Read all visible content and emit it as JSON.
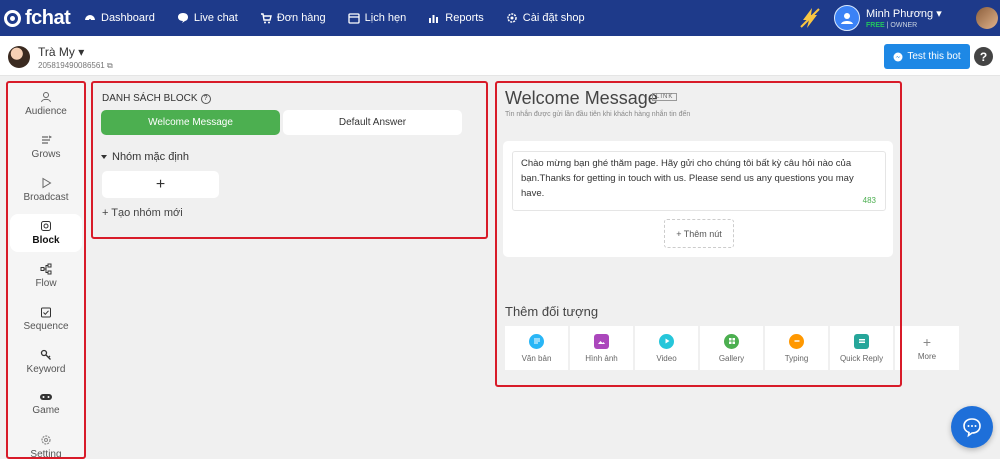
{
  "brand": {
    "name": "fchat"
  },
  "nav": {
    "items": [
      {
        "label": "Dashboard",
        "icon": "dashboard-icon"
      },
      {
        "label": "Live chat",
        "icon": "chat-icon"
      },
      {
        "label": "Đơn hàng",
        "icon": "cart-icon"
      },
      {
        "label": "Lịch hẹn",
        "icon": "calendar-icon"
      },
      {
        "label": "Reports",
        "icon": "chart-icon"
      },
      {
        "label": "Cài đặt shop",
        "icon": "gear-icon"
      }
    ],
    "user": {
      "name": "Minh Phương",
      "plan": "FREE",
      "role": "OWNER"
    }
  },
  "page": {
    "name": "Trà My",
    "id": "2058194900865​61",
    "test_button": "Test this bot",
    "help": "?"
  },
  "sidebar": {
    "items": [
      {
        "label": "Audience",
        "icon": "user-icon",
        "active": false
      },
      {
        "label": "Grows",
        "icon": "grow-icon",
        "active": false
      },
      {
        "label": "Broadcast",
        "icon": "broadcast-icon",
        "active": false
      },
      {
        "label": "Block",
        "icon": "block-icon",
        "active": true
      },
      {
        "label": "Flow",
        "icon": "flow-icon",
        "active": false
      },
      {
        "label": "Sequence",
        "icon": "sequence-icon",
        "active": false
      },
      {
        "label": "Keyword",
        "icon": "key-icon",
        "active": false
      },
      {
        "label": "Game",
        "icon": "gamepad-icon",
        "active": false
      },
      {
        "label": "Setting",
        "icon": "gear-icon",
        "active": false
      }
    ]
  },
  "blocks": {
    "title": "DANH SÁCH BLOCK",
    "help": "?",
    "welcome": "Welcome Message",
    "default": "Default Answer",
    "group_name": "Nhóm mặc định",
    "add_block": "+",
    "new_group": "+ Tạo nhóm mới"
  },
  "editor": {
    "title": "Welcome Message",
    "link_badge": "LINK",
    "subtitle": "Tin nhắn được gửi lần đầu tiên khi khách hàng nhắn tin đến",
    "message": "Chào mừng bạn ghé thăm page. Hãy gửi cho chúng tôi bất kỳ câu hỏi nào của bạn.Thanks for getting in touch with us. Please send us any questions you may have.",
    "char_count": "483",
    "add_button": "+ Thêm nút",
    "add_object_title": "Thêm đối tượng",
    "tools": [
      {
        "label": "Văn bản",
        "icon": "text-icon",
        "color": "#29b6f6"
      },
      {
        "label": "Hình ảnh",
        "icon": "image-icon",
        "color": "#ab47bc"
      },
      {
        "label": "Video",
        "icon": "video-icon",
        "color": "#26c6da"
      },
      {
        "label": "Gallery",
        "icon": "gallery-icon",
        "color": "#4caf50"
      },
      {
        "label": "Typing",
        "icon": "typing-icon",
        "color": "#ff9800"
      },
      {
        "label": "Quick Reply",
        "icon": "quick-reply-icon",
        "color": "#26a69a"
      },
      {
        "label": "More",
        "icon": "plus-icon",
        "color": "#888888"
      }
    ]
  },
  "colors": {
    "nav_bg": "#1e3a8a",
    "primary": "#1e88e5",
    "success": "#4caf50",
    "highlight": "#d81b29"
  }
}
